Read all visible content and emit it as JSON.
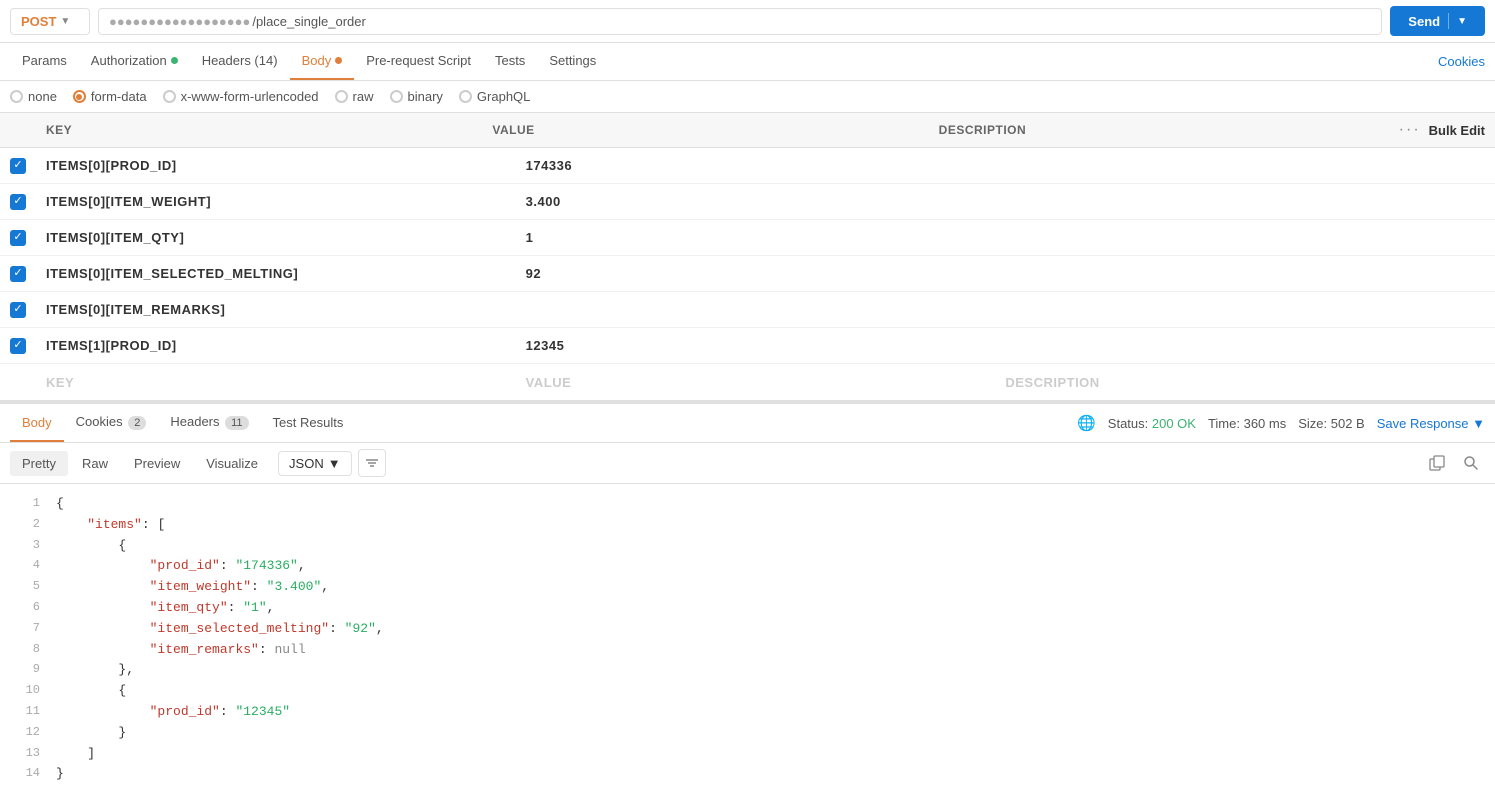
{
  "topbar": {
    "method": "POST",
    "url_prefix": "",
    "url_path": "/place_single_order",
    "send_label": "Send"
  },
  "tabs": [
    {
      "id": "params",
      "label": "Params",
      "dot": null
    },
    {
      "id": "authorization",
      "label": "Authorization",
      "dot": "green"
    },
    {
      "id": "headers",
      "label": "Headers (14)",
      "dot": null
    },
    {
      "id": "body",
      "label": "Body",
      "dot": "orange",
      "active": true
    },
    {
      "id": "pre-request",
      "label": "Pre-request Script",
      "dot": null
    },
    {
      "id": "tests",
      "label": "Tests",
      "dot": null
    },
    {
      "id": "settings",
      "label": "Settings",
      "dot": null
    }
  ],
  "cookies_link": "Cookies",
  "body_types": [
    {
      "id": "none",
      "label": "none",
      "selected": false
    },
    {
      "id": "form-data",
      "label": "form-data",
      "selected": true
    },
    {
      "id": "x-www-form-urlencoded",
      "label": "x-www-form-urlencoded",
      "selected": false
    },
    {
      "id": "raw",
      "label": "raw",
      "selected": false
    },
    {
      "id": "binary",
      "label": "binary",
      "selected": false
    },
    {
      "id": "graphql",
      "label": "GraphQL",
      "selected": false
    }
  ],
  "table": {
    "headers": {
      "key": "KEY",
      "value": "VALUE",
      "description": "DESCRIPTION"
    },
    "bulk_edit_label": "Bulk Edit",
    "rows": [
      {
        "checked": true,
        "key": "items[0][prod_id]",
        "value": "174336",
        "description": ""
      },
      {
        "checked": true,
        "key": "items[0][item_weight]",
        "value": "3.400",
        "description": ""
      },
      {
        "checked": true,
        "key": "items[0][item_qty]",
        "value": "1",
        "description": ""
      },
      {
        "checked": true,
        "key": "items[0][item_selected_melting]",
        "value": "92",
        "description": ""
      },
      {
        "checked": true,
        "key": "items[0][item_remarks]",
        "value": "",
        "description": ""
      },
      {
        "checked": true,
        "key": "items[1][prod_id]",
        "value": "12345",
        "description": ""
      }
    ],
    "placeholder_row": {
      "key": "Key",
      "value": "Value",
      "description": "Description"
    }
  },
  "response": {
    "tabs": [
      {
        "id": "body",
        "label": "Body",
        "active": true,
        "badge": null
      },
      {
        "id": "cookies",
        "label": "Cookies",
        "badge": "2"
      },
      {
        "id": "headers",
        "label": "Headers",
        "badge": "11"
      },
      {
        "id": "test-results",
        "label": "Test Results",
        "badge": null
      }
    ],
    "status": "200 OK",
    "time": "360 ms",
    "size": "502 B",
    "save_response_label": "Save Response"
  },
  "format_tabs": [
    {
      "id": "pretty",
      "label": "Pretty",
      "active": true
    },
    {
      "id": "raw",
      "label": "Raw",
      "active": false
    },
    {
      "id": "preview",
      "label": "Preview",
      "active": false
    },
    {
      "id": "visualize",
      "label": "Visualize",
      "active": false
    }
  ],
  "json_format": "JSON",
  "code_lines": [
    {
      "num": 1,
      "content": "{"
    },
    {
      "num": 2,
      "content": "    \"items\": ["
    },
    {
      "num": 3,
      "content": "        {"
    },
    {
      "num": 4,
      "content": "            \"prod_id\": \"174336\","
    },
    {
      "num": 5,
      "content": "            \"item_weight\": \"3.400\","
    },
    {
      "num": 6,
      "content": "            \"item_qty\": \"1\","
    },
    {
      "num": 7,
      "content": "            \"item_selected_melting\": \"92\","
    },
    {
      "num": 8,
      "content": "            \"item_remarks\": null"
    },
    {
      "num": 9,
      "content": "        },"
    },
    {
      "num": 10,
      "content": "        {"
    },
    {
      "num": 11,
      "content": "            \"prod_id\": \"12345\""
    },
    {
      "num": 12,
      "content": "        }"
    },
    {
      "num": 13,
      "content": "    ]"
    },
    {
      "num": 14,
      "content": "}"
    }
  ]
}
